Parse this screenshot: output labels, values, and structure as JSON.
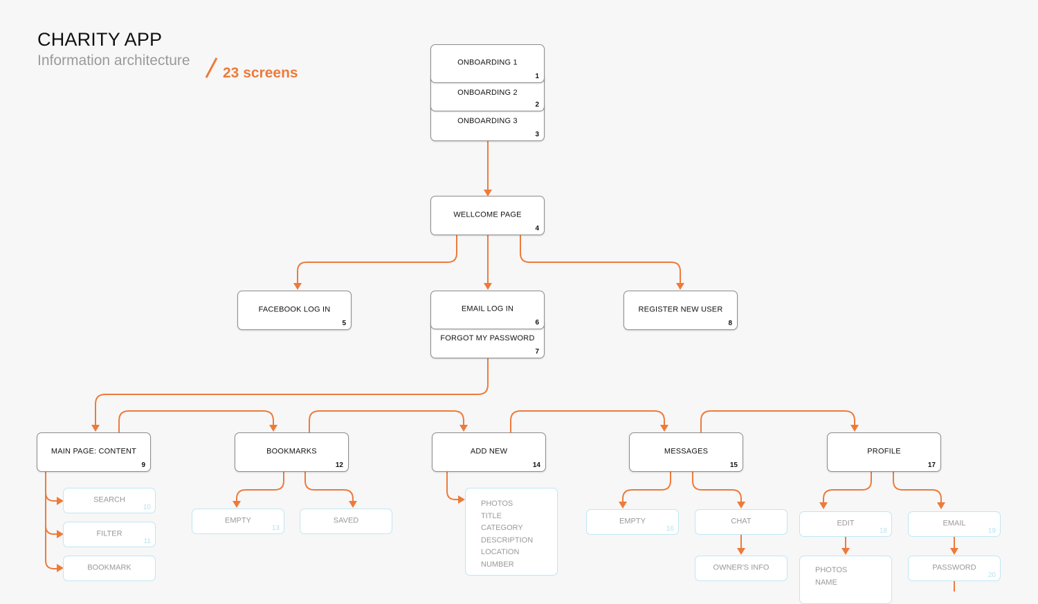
{
  "header": {
    "title": "CHARITY APP",
    "subtitle": "Information architecture",
    "screen_count": "23 screens"
  },
  "colors": {
    "accent": "#ee7a3a",
    "node_border": "#8c8c8c",
    "sub_border": "#bfe6f2",
    "background": "#f7f7f7"
  },
  "nodes": {
    "onboarding1": {
      "label": "ONBOARDING 1",
      "num": "1"
    },
    "onboarding2": {
      "label": "ONBOARDING 2",
      "num": "2"
    },
    "onboarding3": {
      "label": "ONBOARDING 3",
      "num": "3"
    },
    "welcome": {
      "label": "WELLCOME PAGE",
      "num": "4"
    },
    "facebook": {
      "label": "FACEBOOK LOG IN",
      "num": "5"
    },
    "email_login": {
      "label": "EMAIL LOG IN",
      "num": "6"
    },
    "forgot": {
      "label": "FORGOT MY PASSWORD",
      "num": "7"
    },
    "register": {
      "label": "REGISTER NEW USER",
      "num": "8"
    },
    "main": {
      "label": "MAIN PAGE: CONTENT",
      "num": "9"
    },
    "bookmarks": {
      "label": "BOOKMARKS",
      "num": "12"
    },
    "add_new": {
      "label": "ADD NEW",
      "num": "14"
    },
    "messages": {
      "label": "MESSAGES",
      "num": "15"
    },
    "profile": {
      "label": "PROFILE",
      "num": "17"
    }
  },
  "subs": {
    "search": {
      "label": "SEARCH",
      "num": "10"
    },
    "filter": {
      "label": "FILTER",
      "num": "11"
    },
    "bookmark": {
      "label": "BOOKMARK",
      "num": ""
    },
    "bm_empty": {
      "label": "EMPTY",
      "num": "13"
    },
    "saved": {
      "label": "SAVED",
      "num": ""
    },
    "add_fields": [
      "PHOTOS",
      "TITLE",
      "CATEGORY",
      "DESCRIPTION",
      "LOCATION",
      "NUMBER"
    ],
    "msg_empty": {
      "label": "EMPTY",
      "num": "16"
    },
    "chat": {
      "label": "CHAT",
      "num": ""
    },
    "owners_info": {
      "label": "OWNER'S INFO",
      "num": ""
    },
    "edit": {
      "label": "EDIT",
      "num": "18"
    },
    "edit_fields": [
      "PHOTOS",
      "NAME"
    ],
    "email": {
      "label": "EMAIL",
      "num": "19"
    },
    "password": {
      "label": "PASSWORD",
      "num": "20"
    }
  }
}
